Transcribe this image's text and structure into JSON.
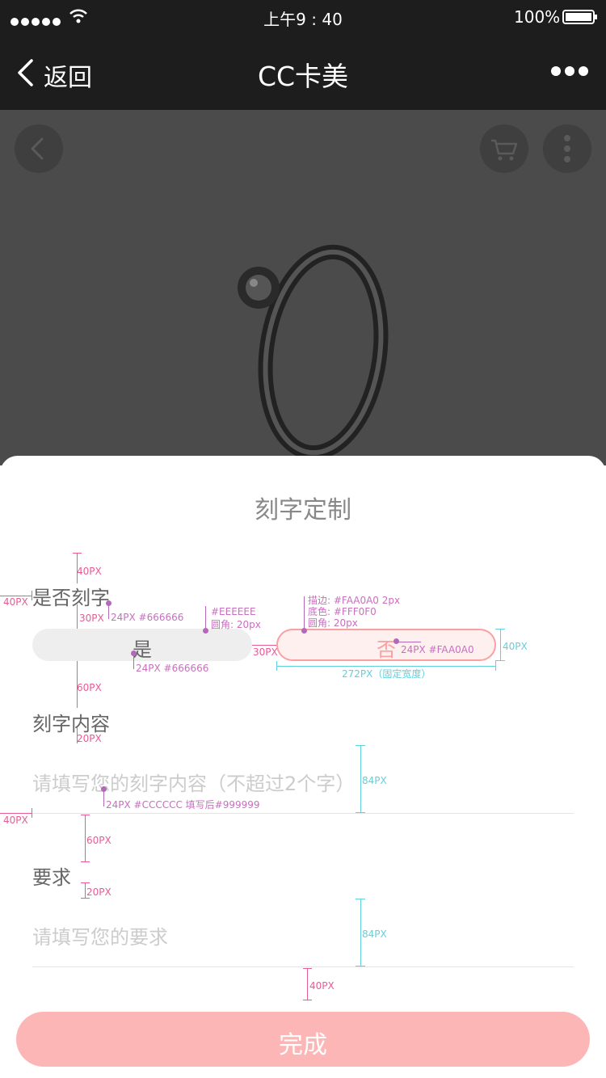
{
  "status_bar": {
    "time": "上午9 : 40",
    "battery": "100%"
  },
  "nav": {
    "back_label": "返回",
    "title": "CC卡美"
  },
  "modal": {
    "title": "刻字定制",
    "engrave_question": "是否刻字",
    "option_yes": "是",
    "option_no": "否",
    "content_label": "刻字内容",
    "content_placeholder": "请填写您的刻字内容（不超过2个字）",
    "requirement_label": "要求",
    "requirement_placeholder": "请填写您的要求",
    "done_label": "完成"
  },
  "annotations": {
    "a40_1": "40PX",
    "a40_left_1": "40PX",
    "a30_1": "30PX",
    "a24_666_1": "24PX #666666",
    "eeeeee": "#EEEEEE",
    "radius_20_1": "圆角: 20px",
    "stroke": "描边: #FAA0A0 2px",
    "bg_color": "底色: #FFF0F0",
    "radius_20_2": "圆角: 20px",
    "a30_2": "30PX",
    "a24_faa0a0": "24PX #FAA0A0",
    "a40_right": "40PX",
    "a24_666_2": "24PX #666666",
    "a272": "272PX（固定宽度）",
    "a60_1": "60PX",
    "a20_1": "20PX",
    "a84_1": "84PX",
    "a24_ccc": "24PX #CCCCCC  填写后#999999",
    "a40_left_2": "40PX",
    "a60_2": "60PX",
    "a20_2": "20PX",
    "a84_2": "84PX",
    "a40_bottom": "40PX"
  },
  "colors": {
    "nav_bg": "#1d1d1d",
    "selected_border": "#FAA0A0",
    "selected_bg": "#FFF0F0",
    "unselected_bg": "#EEEEEE",
    "done_bg": "#FDB6B6"
  }
}
